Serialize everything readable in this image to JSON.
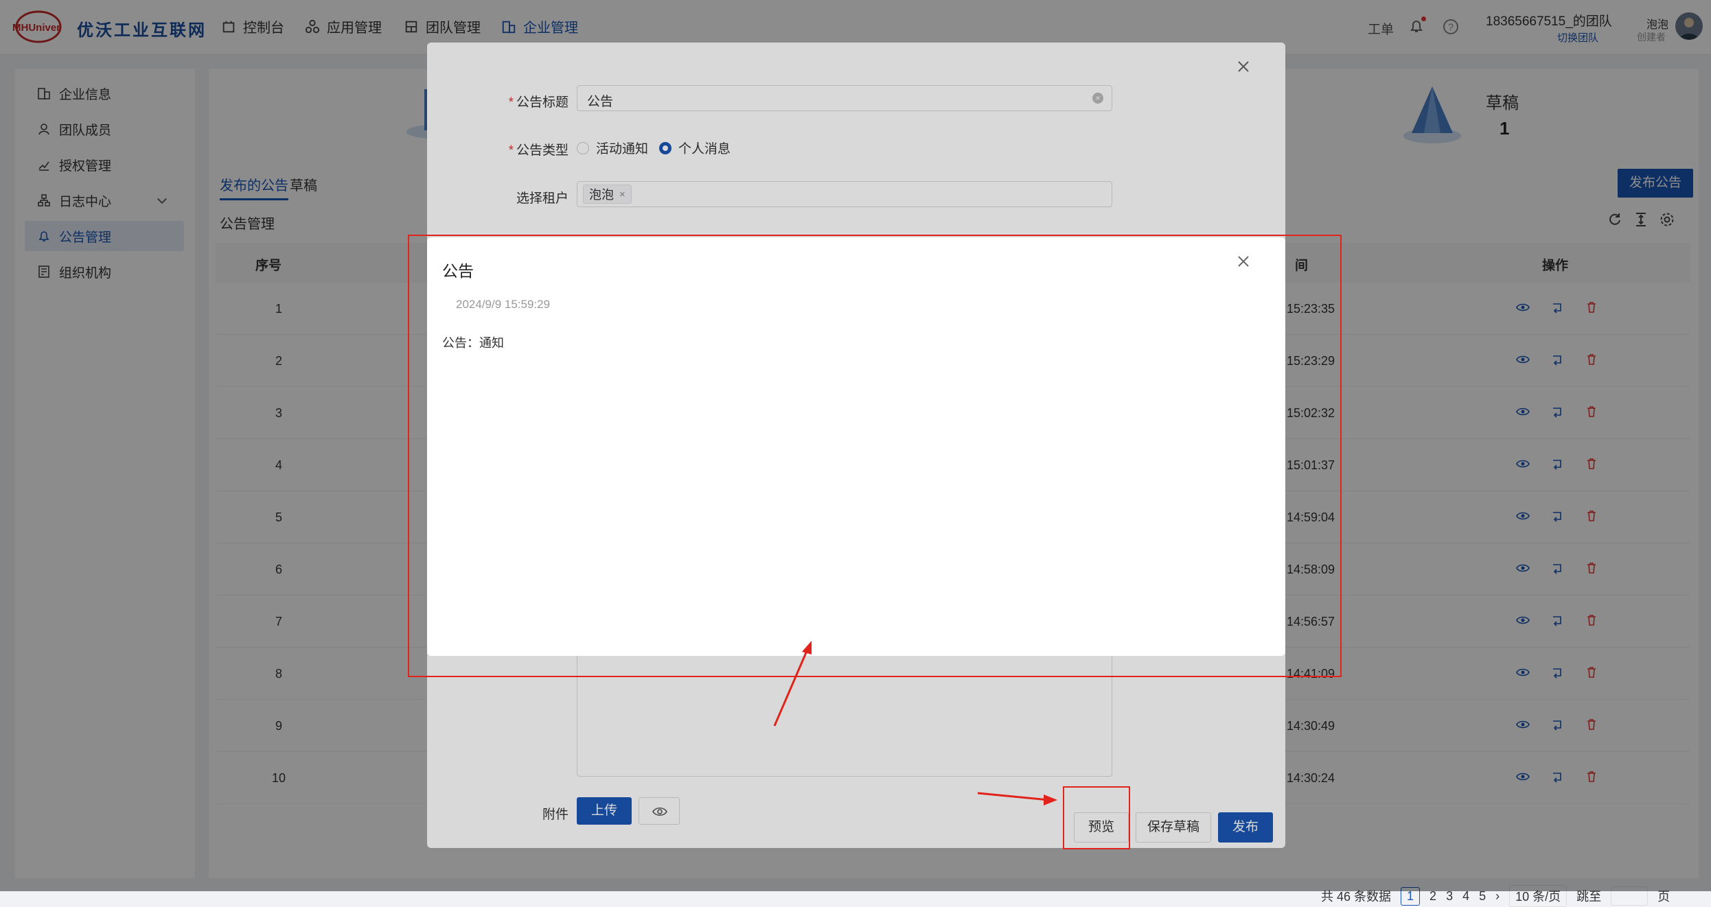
{
  "nav": {
    "logo_text": "MHUniver",
    "brand": "优沃工业互联网",
    "items": [
      {
        "label": "控制台",
        "icon": "dashboard-icon"
      },
      {
        "label": "应用管理",
        "icon": "apps-icon"
      },
      {
        "label": "团队管理",
        "icon": "team-icon"
      },
      {
        "label": "企业管理",
        "icon": "enterprise-icon",
        "active": true
      }
    ],
    "ticket": "工单",
    "team_name": "18365667515_的团队",
    "switch_team": "切换团队",
    "user_name": "泡泡",
    "user_role": "创建者"
  },
  "sidebar": {
    "items": [
      {
        "label": "企业信息",
        "icon": "building-icon"
      },
      {
        "label": "团队成员",
        "icon": "user-icon"
      },
      {
        "label": "授权管理",
        "icon": "authorize-icon"
      },
      {
        "label": "日志中心",
        "icon": "log-icon",
        "expandable": true
      },
      {
        "label": "公告管理",
        "icon": "bell-icon",
        "active": true
      },
      {
        "label": "组织机构",
        "icon": "org-icon"
      }
    ]
  },
  "main": {
    "draft_label": "草稿",
    "draft_count": "1",
    "tabs": [
      "发布的公告",
      "草稿"
    ],
    "section_title": "公告管理",
    "publish_button": "发布公告",
    "table": {
      "headers": {
        "seq": "序号",
        "time_tail": "间",
        "ops": "操作"
      },
      "rows": [
        {
          "seq": "1",
          "time": "15:23:35"
        },
        {
          "seq": "2",
          "time": "15:23:29"
        },
        {
          "seq": "3",
          "time": "15:02:32"
        },
        {
          "seq": "4",
          "time": "15:01:37"
        },
        {
          "seq": "5",
          "time": "14:59:04"
        },
        {
          "seq": "6",
          "time": "14:58:09"
        },
        {
          "seq": "7",
          "time": "14:56:57"
        },
        {
          "seq": "8",
          "time": "14:41:09"
        },
        {
          "seq": "9",
          "time": "14:30:49"
        },
        {
          "seq": "10",
          "time": "14:30:24"
        }
      ]
    },
    "pager": {
      "total": "共 46 条数据",
      "pages": [
        "1",
        "2",
        "3",
        "4",
        "5"
      ],
      "current": "1",
      "page_size": "10 条/页",
      "jump": "跳至",
      "page_suffix": "页"
    }
  },
  "form_dialog": {
    "title_label": "公告标题",
    "title_value": "公告",
    "type_label": "公告类型",
    "type_options": [
      "活动通知",
      "个人消息"
    ],
    "type_selected": "个人消息",
    "tenant_label": "选择租户",
    "tenant_tag": "泡泡",
    "attachment_label": "附件",
    "upload_button": "上传",
    "preview_button": "预览",
    "save_draft_button": "保存草稿",
    "publish_button": "发布"
  },
  "preview_dialog": {
    "title": "公告",
    "date": "2024/9/9 15:59:29",
    "body": "公告：通知"
  },
  "colors": {
    "primary": "#1a56b4",
    "annotation_red": "#e0241b"
  }
}
